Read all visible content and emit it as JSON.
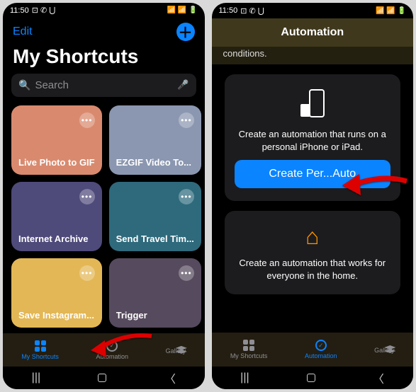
{
  "status": {
    "time": "11:50",
    "icons": "⊡ ✆ ⋃",
    "right": "📶 📶 🔋"
  },
  "left": {
    "edit": "Edit",
    "title": "My Shortcuts",
    "search_placeholder": "Search",
    "tiles": [
      {
        "label": "Live Photo to GIF",
        "color": "#d98a6e"
      },
      {
        "label": "EZGIF Video To...",
        "color": "#8b97b0"
      },
      {
        "label": "Internet Archive",
        "color": "#4e4a7a"
      },
      {
        "label": "Send Travel Tim...",
        "color": "#2e6a7c"
      },
      {
        "label": "Save Instagram...",
        "color": "#e3b755"
      },
      {
        "label": "Trigger",
        "color": "#564a5e"
      }
    ],
    "tabs": {
      "shortcuts": "My Shortcuts",
      "automation": "Automation",
      "gallery": "Gallery"
    }
  },
  "right": {
    "header": "Automation",
    "intro": "conditions.",
    "card_personal": {
      "desc": "Create an automation that runs on a personal iPhone or iPad.",
      "cta": "Create Per...Auto"
    },
    "card_home": {
      "desc": "Create an automation that works for everyone in the home."
    },
    "tabs": {
      "shortcuts": "My Shortcuts",
      "automation": "Automation",
      "gallery": "Gallery"
    }
  }
}
